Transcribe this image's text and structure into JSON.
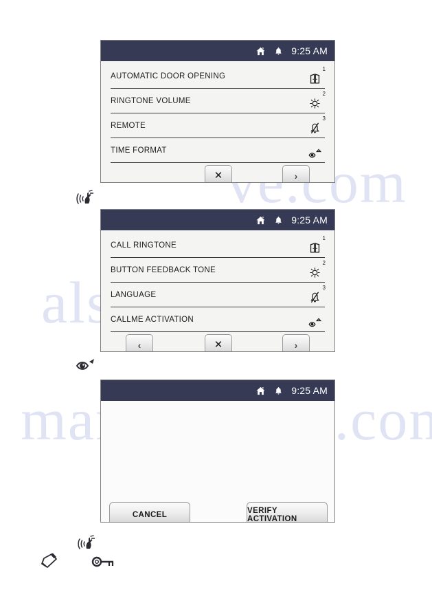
{
  "statusbar": {
    "time": "9:25 AM",
    "home_icon": "home-icon",
    "bell_icon": "bell-icon"
  },
  "panels": [
    {
      "id": "panel-settings-page-1",
      "rows": [
        {
          "label": "AUTOMATIC DOOR OPENING",
          "sup": "1",
          "icon": "double-door-icon"
        },
        {
          "label": "RINGTONE VOLUME",
          "sup": "2",
          "icon": "brightness-sun-icon"
        },
        {
          "label": "REMOTE",
          "sup": "3",
          "icon": "muted-bell-icon"
        },
        {
          "label": "TIME FORMAT",
          "sup": "",
          "icon": "eye-caret-icon"
        }
      ],
      "buttons": [
        {
          "name": "close-button",
          "glyph": "✕",
          "kind": "x"
        },
        {
          "name": "next-page-button",
          "glyph": "›",
          "kind": "nav"
        }
      ]
    },
    {
      "id": "panel-settings-page-2",
      "rows": [
        {
          "label": "CALL RINGTONE",
          "sup": "1",
          "icon": "double-door-icon"
        },
        {
          "label": "BUTTON FEEDBACK TONE",
          "sup": "2",
          "icon": "brightness-sun-icon"
        },
        {
          "label": "LANGUAGE",
          "sup": "3",
          "icon": "muted-bell-icon"
        },
        {
          "label": "CALLME ACTIVATION",
          "sup": "",
          "icon": "eye-caret-icon"
        }
      ],
      "buttons": [
        {
          "name": "previous-page-button",
          "glyph": "‹",
          "kind": "nav"
        },
        {
          "name": "close-button",
          "glyph": "✕",
          "kind": "x"
        },
        {
          "name": "next-page-button",
          "glyph": "›",
          "kind": "nav"
        }
      ]
    },
    {
      "id": "panel-verify-activation",
      "rows": [],
      "buttons": [
        {
          "name": "cancel-button",
          "label": "CANCEL"
        },
        {
          "name": "verify-activation-button",
          "label": "VERIFY ACTIVATION"
        }
      ]
    }
  ],
  "annotations": [
    {
      "name": "remote-signal-icon",
      "note": "hand with signal waves"
    },
    {
      "name": "eye-caret-icon",
      "note": "eye with pointer"
    },
    {
      "name": "remote-signal-icon",
      "note": "hand with signal waves"
    },
    {
      "name": "notepad-icon",
      "note": "notepad"
    },
    {
      "name": "key-icon",
      "note": "key"
    }
  ],
  "watermark": {
    "line_a": "manualshive.com",
    "line_b": "ve.com",
    "line_c": "alshive"
  },
  "colors": {
    "statusbar_bg": "#363a54",
    "panel_bg": "#f2f2f0",
    "panel_border": "#7d7d7d",
    "text": "#1b1b1b",
    "watermark": "#9aa6d8"
  }
}
